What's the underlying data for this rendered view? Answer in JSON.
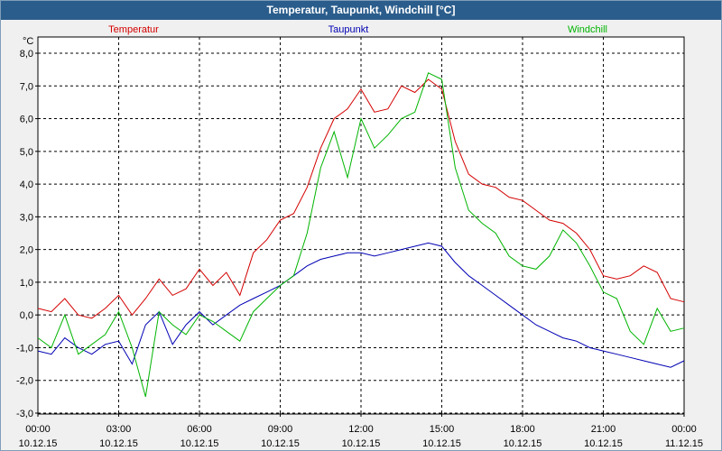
{
  "window": {
    "title": "Temperatur, Taupunkt, Windchill [°C]"
  },
  "chart_data": {
    "type": "line",
    "title": "Temperatur, Taupunkt, Windchill [°C]",
    "ylabel": "°C",
    "xlabel": "",
    "ylim": [
      -3.0,
      8.0
    ],
    "grid": true,
    "legend": "top",
    "yticks": [
      "8,0",
      "7,0",
      "6,0",
      "5,0",
      "4,0",
      "3,0",
      "2,0",
      "1,0",
      "0,0",
      "-1,0",
      "-2,0",
      "-3,0"
    ],
    "xticks": [
      {
        "time": "00:00",
        "date": "10.12.15"
      },
      {
        "time": "03:00",
        "date": "10.12.15"
      },
      {
        "time": "06:00",
        "date": "10.12.15"
      },
      {
        "time": "09:00",
        "date": "10.12.15"
      },
      {
        "time": "12:00",
        "date": "10.12.15"
      },
      {
        "time": "15:00",
        "date": "10.12.15"
      },
      {
        "time": "18:00",
        "date": "10.12.15"
      },
      {
        "time": "21:00",
        "date": "10.12.15"
      },
      {
        "time": "00:00",
        "date": "11.12.15"
      }
    ],
    "x_hours": [
      0,
      0.5,
      1,
      1.5,
      2,
      2.5,
      3,
      3.5,
      4,
      4.5,
      5,
      5.5,
      6,
      6.5,
      7,
      7.5,
      8,
      8.5,
      9,
      9.5,
      10,
      10.5,
      11,
      11.5,
      12,
      12.5,
      13,
      13.5,
      14,
      14.5,
      15,
      15.5,
      16,
      16.5,
      17,
      17.5,
      18,
      18.5,
      19,
      19.5,
      20,
      20.5,
      21,
      21.5,
      22,
      22.5,
      23,
      23.5,
      24
    ],
    "series": [
      {
        "name": "Temperatur",
        "color": "#d40000",
        "values": [
          0.2,
          0.1,
          0.5,
          0.0,
          -0.1,
          0.2,
          0.6,
          0.0,
          0.5,
          1.1,
          0.6,
          0.8,
          1.4,
          0.9,
          1.3,
          0.6,
          1.9,
          2.3,
          2.9,
          3.1,
          3.9,
          5.1,
          6.0,
          6.3,
          6.9,
          6.2,
          6.3,
          7.0,
          6.8,
          7.2,
          6.9,
          5.3,
          4.3,
          4.0,
          3.9,
          3.6,
          3.5,
          3.2,
          2.9,
          2.8,
          2.5,
          2.0,
          1.2,
          1.1,
          1.2,
          1.5,
          1.3,
          0.5,
          0.4
        ]
      },
      {
        "name": "Taupunkt",
        "color": "#0000b4",
        "values": [
          -1.1,
          -1.2,
          -0.7,
          -1.0,
          -1.2,
          -0.9,
          -0.8,
          -1.5,
          -0.3,
          0.1,
          -0.9,
          -0.3,
          0.1,
          -0.3,
          0.0,
          0.3,
          0.5,
          0.7,
          0.9,
          1.2,
          1.5,
          1.7,
          1.8,
          1.9,
          1.9,
          1.8,
          1.9,
          2.0,
          2.1,
          2.2,
          2.1,
          1.6,
          1.2,
          0.9,
          0.6,
          0.3,
          0.0,
          -0.3,
          -0.5,
          -0.7,
          -0.8,
          -1.0,
          -1.1,
          -1.2,
          -1.3,
          -1.4,
          -1.5,
          -1.6,
          -1.4
        ]
      },
      {
        "name": "Windchill",
        "color": "#00b400",
        "values": [
          -0.7,
          -1.0,
          0.0,
          -1.2,
          -0.9,
          -0.6,
          0.1,
          -1.0,
          -2.5,
          0.1,
          -0.3,
          -0.6,
          0.0,
          -0.2,
          -0.5,
          -0.8,
          0.1,
          0.5,
          0.9,
          1.2,
          2.5,
          4.5,
          5.6,
          4.2,
          6.0,
          5.1,
          5.5,
          6.0,
          6.2,
          7.4,
          7.2,
          4.5,
          3.2,
          2.8,
          2.5,
          1.8,
          1.5,
          1.4,
          1.8,
          2.6,
          2.2,
          1.5,
          0.7,
          0.5,
          -0.5,
          -0.9,
          0.2,
          -0.5,
          -0.4
        ]
      }
    ]
  }
}
